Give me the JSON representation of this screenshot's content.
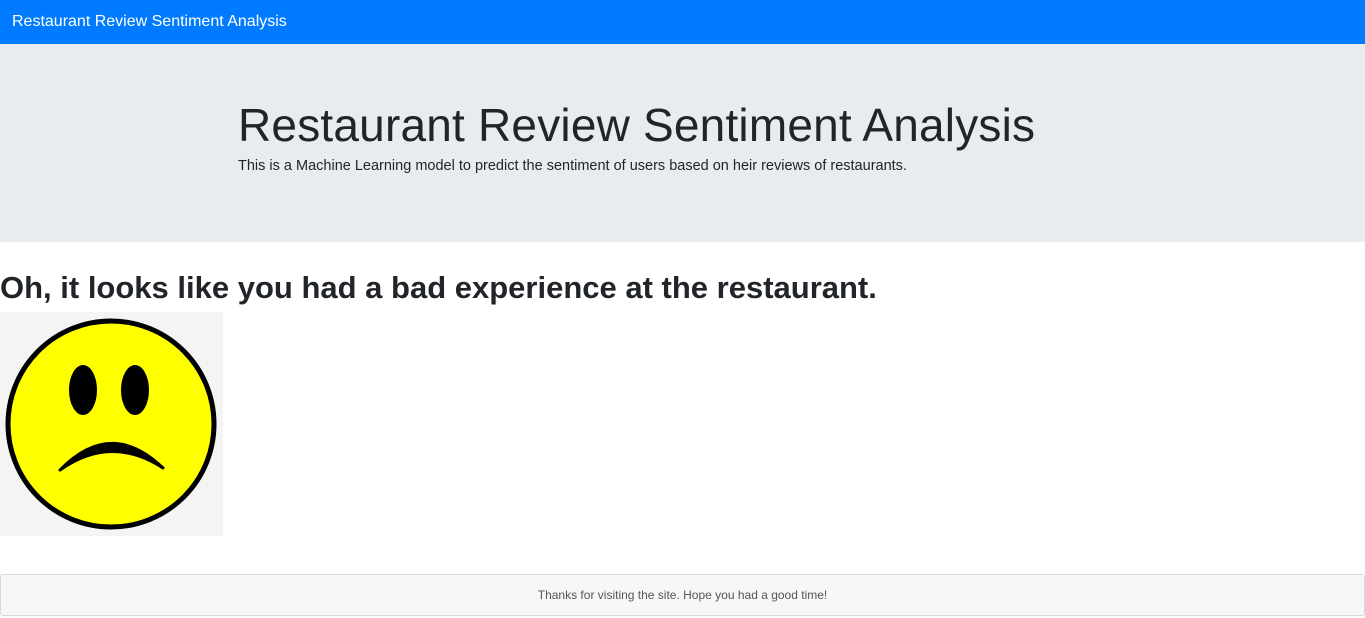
{
  "navbar": {
    "brand": "Restaurant Review Sentiment Analysis",
    "background_color": "#007bff"
  },
  "jumbotron": {
    "title": "Restaurant Review Sentiment Analysis",
    "lead": "This is a Machine Learning model to predict the sentiment of users based on heir reviews of restaurants.",
    "background_color": "#e9ecef"
  },
  "result": {
    "heading": "Oh, it looks like you had a bad experience at the restaurant.",
    "image_icon": "sad-face-icon",
    "face_color": "#ffff00"
  },
  "footer": {
    "text": "Thanks for visiting the site. Hope you had a good time!"
  }
}
